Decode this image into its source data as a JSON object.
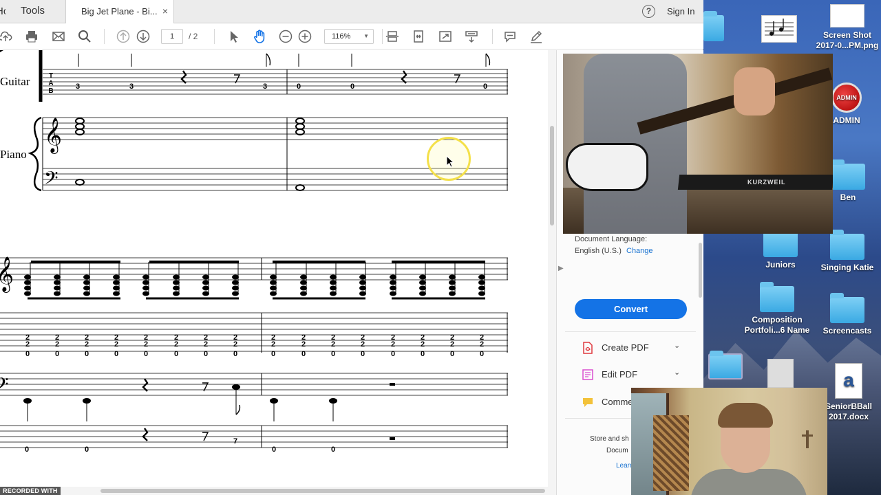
{
  "tabs": {
    "home_label": "Home",
    "tools_label": "Tools",
    "document_tab_label": "Big Jet Plane - Bi...",
    "close_glyph": "×"
  },
  "header": {
    "help_glyph": "?",
    "sign_in_label": "Sign In"
  },
  "toolbar": {
    "page_current": "1",
    "page_total": "/ 2",
    "zoom_level": "116%",
    "icons": [
      "cloud-upload-icon",
      "print-icon",
      "email-icon",
      "search-icon",
      "page-up-icon",
      "page-down-icon",
      "select-arrow-icon",
      "hand-tool-icon",
      "zoom-out-icon",
      "zoom-in-icon",
      "scroll-mode-icon",
      "fit-page-icon",
      "fullscreen-icon",
      "read-mode-icon",
      "comment-icon",
      "sign-pen-icon"
    ]
  },
  "score": {
    "guitar_label": "Guitar",
    "piano_label": "Piano",
    "tab_label_top": [
      "T",
      "A",
      "B"
    ],
    "system1_tab_numbers": [
      "3",
      "3",
      "3",
      "0",
      "0",
      "0"
    ],
    "system2_tab_row1": [
      "2",
      "2",
      "2",
      "2",
      "2",
      "2",
      "2",
      "2",
      "2",
      "2",
      "2",
      "2",
      "2",
      "2",
      "2",
      "2"
    ],
    "system2_tab_row2": [
      "2",
      "2",
      "2",
      "2",
      "2",
      "2",
      "2",
      "2",
      "2",
      "2",
      "2",
      "2",
      "2",
      "2",
      "2",
      "2"
    ],
    "system2_tab_row3": [
      "0",
      "0",
      "0",
      "0",
      "0",
      "0",
      "0",
      "0",
      "0",
      "0",
      "0",
      "0",
      "0",
      "0",
      "0",
      "0"
    ],
    "system2_bass_tab": [
      "0",
      "0",
      "7",
      "0",
      "0"
    ]
  },
  "right_pane": {
    "doc_language_label": "Document Language:",
    "doc_language_value": "English (U.S.)",
    "change_link": "Change",
    "convert_button": "Convert",
    "tools": [
      {
        "label": "Create PDF",
        "icon": "create-pdf-icon",
        "color": "#e0393e"
      },
      {
        "label": "Edit PDF",
        "icon": "edit-pdf-icon",
        "color": "#d94fd0"
      },
      {
        "label": "Comme",
        "icon": "comment-tool-icon",
        "color": "#f3c23a"
      }
    ],
    "chevron_glyph": "⌄",
    "store_line1": "Store and sh",
    "store_line2": "Docum",
    "learn_link": "Learn"
  },
  "desktop": {
    "icons": [
      {
        "label": "Screen Shot 2017-0...PM.png",
        "icon": "screenshot-file-icon"
      },
      {
        "label": "ADMIN",
        "icon": "admin-badge-icon",
        "badge": "ADMIN"
      },
      {
        "label": "Ben",
        "icon": "folder-icon"
      },
      {
        "label": "Juniors",
        "icon": "folder-icon"
      },
      {
        "label": "Singing Katie",
        "icon": "folder-icon"
      },
      {
        "label": "Composition Portfoli...6 Name",
        "icon": "folder-icon"
      },
      {
        "label": "Screencasts",
        "icon": "folder-icon"
      },
      {
        "label": "SeniorBBall 2017.docx",
        "icon": "word-document-icon"
      }
    ]
  },
  "overlays": {
    "recorded_with": "RECORDED WITH",
    "keyboard_brand": "KURZWEIL"
  },
  "colors": {
    "accent_blue": "#1473e6",
    "link_blue": "#1a73d1",
    "cursor_highlight": "#f4e04a"
  }
}
